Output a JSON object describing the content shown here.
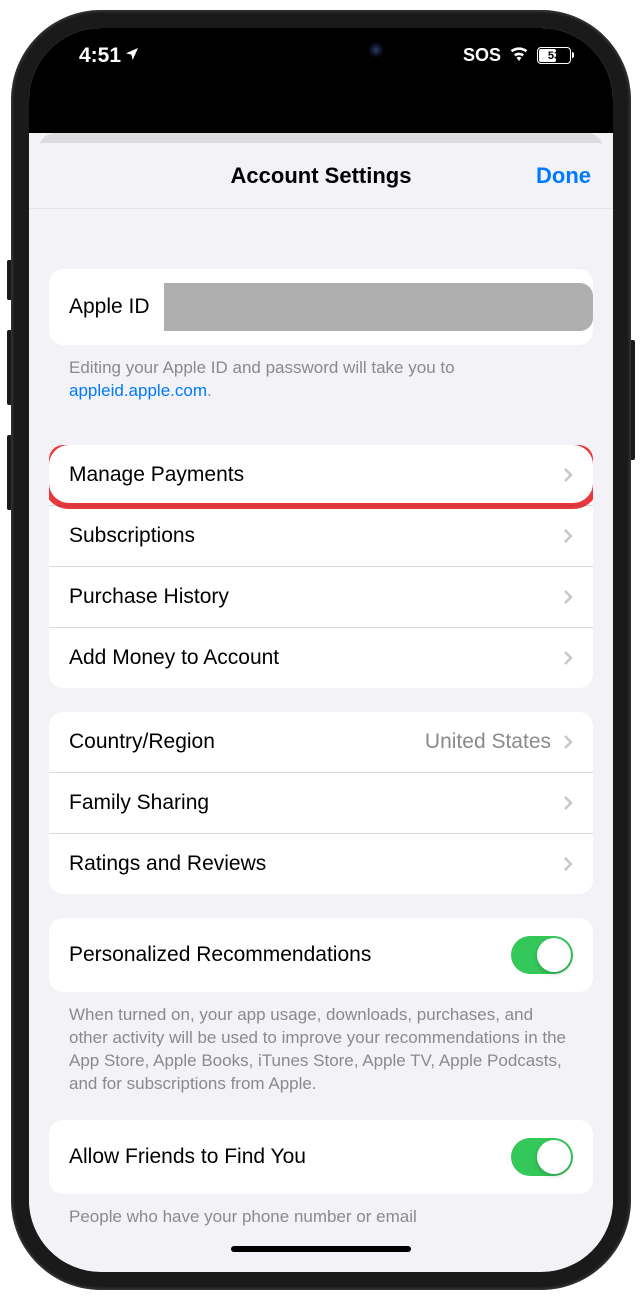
{
  "status_bar": {
    "time": "4:51",
    "sos": "SOS",
    "battery_level": "53"
  },
  "header": {
    "title": "Account Settings",
    "done": "Done"
  },
  "apple_id": {
    "label": "Apple ID",
    "footer": "Editing your Apple ID and password will take you to ",
    "footer_link": "appleid.apple.com",
    "footer_suffix": "."
  },
  "group1": {
    "manage_payments": "Manage Payments",
    "subscriptions": "Subscriptions",
    "purchase_history": "Purchase History",
    "add_money": "Add Money to Account"
  },
  "group2": {
    "country_region_label": "Country/Region",
    "country_region_value": "United States",
    "family_sharing": "Family Sharing",
    "ratings_reviews": "Ratings and Reviews"
  },
  "group3": {
    "personalized": "Personalized Recommendations",
    "footer": "When turned on, your app usage, downloads, purchases, and other activity will be used to improve your recommendations in the App Store, Apple Books, iTunes Store, Apple TV, Apple Podcasts, and for subscriptions from Apple."
  },
  "group4": {
    "allow_friends": "Allow Friends to Find You",
    "footer": "People who have your phone number or email"
  }
}
